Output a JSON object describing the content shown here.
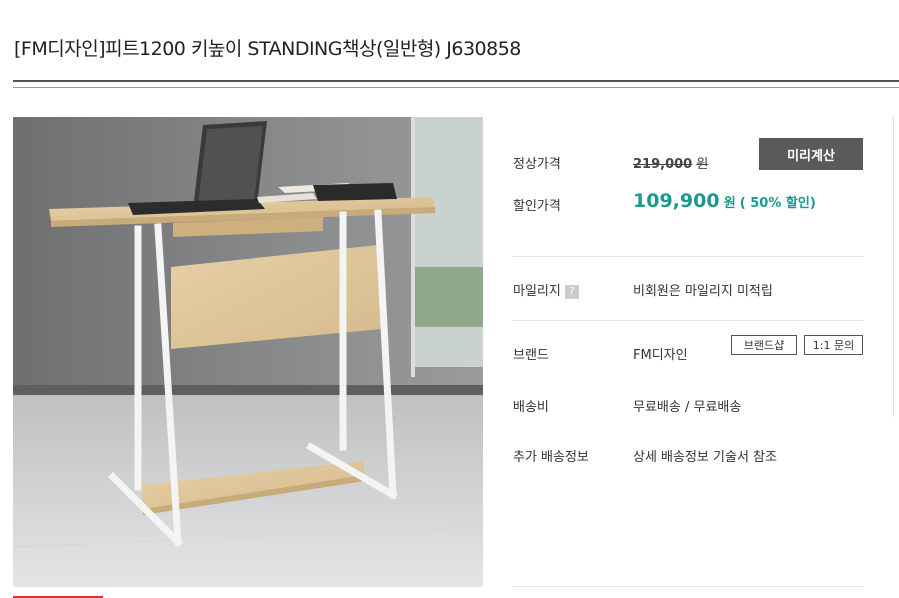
{
  "product": {
    "title": "[FM디자인]피트1200 키높이 STANDING책상(일반형) J630858"
  },
  "pricing": {
    "normal_label": "정상가격",
    "normal_price": "219,000",
    "normal_unit": "원",
    "calc_button": "미리계산",
    "sale_label": "할인가격",
    "sale_price": "109,900",
    "sale_unit": "원",
    "discount_text": "( 50% 할인)"
  },
  "mileage": {
    "label": "마일리지",
    "help": "?",
    "value": "비회원은 마일리지 미적립"
  },
  "brand": {
    "label": "브랜드",
    "value": "FM디자인",
    "shop_button": "브랜드샵",
    "inquiry_button": "1:1 문의"
  },
  "shipping": {
    "label": "배송비",
    "value": "무료배송 / 무료배송"
  },
  "extra_shipping": {
    "label": "추가 배송정보",
    "value": "상세 배송정보 기술서 참조"
  },
  "colors": {
    "sale": "#1a9a8e",
    "button_dark": "#5a5a5a",
    "accent_red": "#e03030"
  }
}
